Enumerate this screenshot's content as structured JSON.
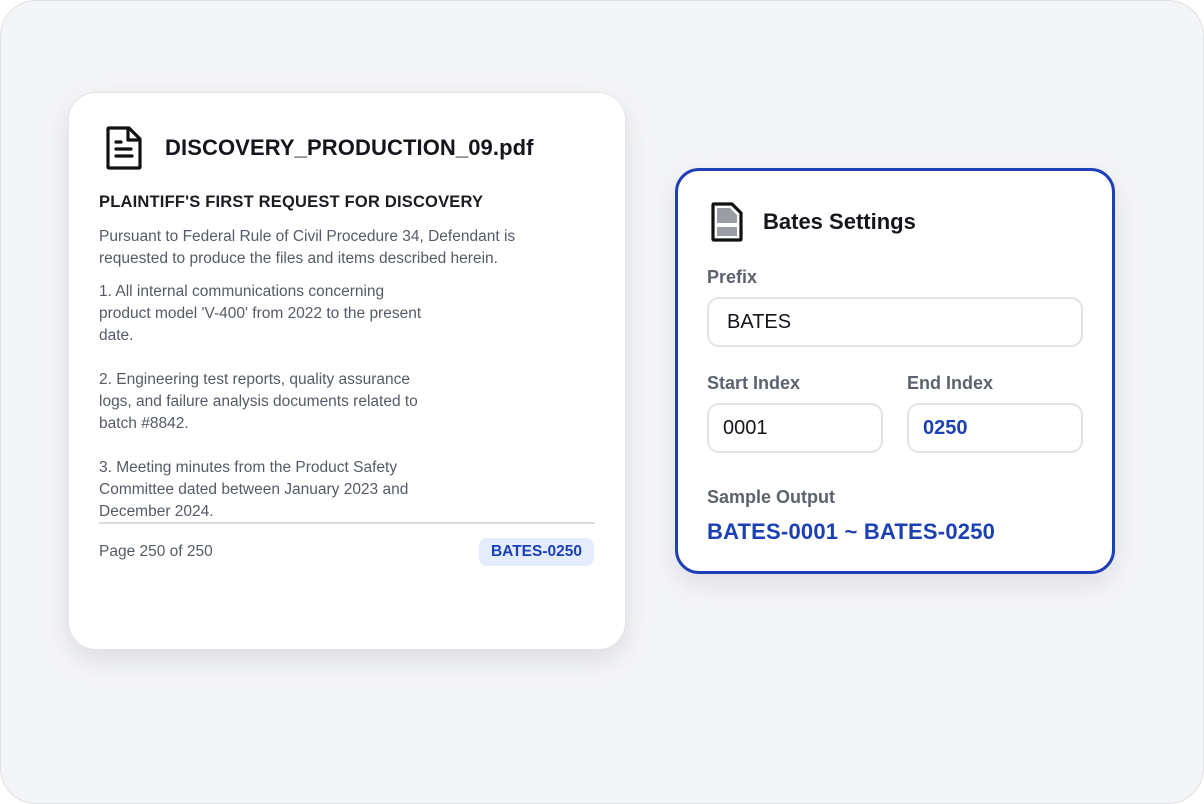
{
  "document": {
    "filename": "DISCOVERY_PRODUCTION_09.pdf",
    "heading": "PLAINTIFF'S FIRST REQUEST FOR DISCOVERY",
    "intro": "Pursuant to Federal Rule of Civil Procedure 34, Defendant is requested to produce the files and items described herein.",
    "items": [
      "1. All internal communications concerning product model 'V-400' from 2022 to the present date.",
      "2. Engineering test reports, quality assurance logs, and failure analysis documents related to batch #8842.",
      "3. Meeting minutes from the Product Safety Committee dated between January 2023 and December 2024."
    ],
    "page_indicator": "Page 250 of 250",
    "bates_stamp": "BATES-0250",
    "icon": "document-icon"
  },
  "settings": {
    "title": "Bates Settings",
    "icon": "bates-file-icon",
    "prefix_label": "Prefix",
    "prefix_value": "BATES",
    "start_label": "Start Index",
    "start_value": "0001",
    "end_label": "End Index",
    "end_value": "0250",
    "sample_label": "Sample Output",
    "sample_value": "BATES-0001 ~ BATES-0250"
  },
  "colors": {
    "accent": "#1f3fb8",
    "badge_bg": "#e3edff",
    "background": "#f4f5f7"
  }
}
